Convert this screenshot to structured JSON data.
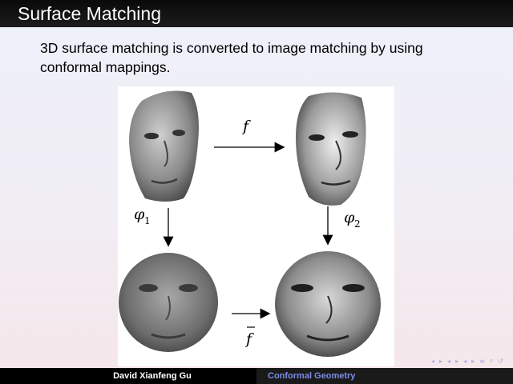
{
  "slide": {
    "title": "Surface Matching",
    "body_line1": "3D surface matching is converted to image matching by using",
    "body_line2": "conformal mappings."
  },
  "figure": {
    "labels": {
      "f": "f",
      "phi1": "φ",
      "phi1_sub": "1",
      "phi2": "φ",
      "phi2_sub": "2",
      "fbar": "f"
    }
  },
  "navigation": {
    "icons": [
      "frame-prev-icon",
      "frame-next-icon",
      "section-prev-icon",
      "section-next-icon",
      "subsection-prev-icon",
      "subsection-next-icon",
      "menu-icon",
      "search-icon",
      "undo-icon"
    ]
  },
  "footer": {
    "author": "David Xianfeng Gu",
    "topic": "Conformal Geometry"
  },
  "colors": {
    "title_bar": "#0a0a0a",
    "footer_topic": "#7d8ce8",
    "nav_icons": "#a9aee0"
  }
}
